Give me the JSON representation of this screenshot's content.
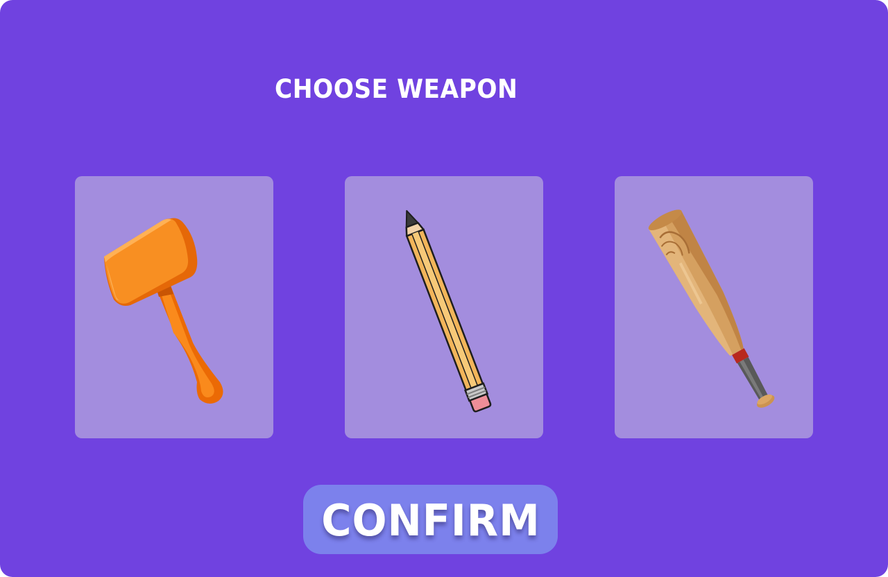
{
  "screen": {
    "title": "CHOOSE WEAPON",
    "background_color": "#7042E0"
  },
  "weapons": [
    {
      "name": "hammer",
      "icon": "hammer-icon"
    },
    {
      "name": "pencil",
      "icon": "pencil-icon"
    },
    {
      "name": "baseball bat",
      "icon": "baseball-bat-icon"
    }
  ],
  "card_color": "#A38DDE",
  "confirm_button": {
    "label": "CONFIRM",
    "color": "#7C81EC"
  }
}
